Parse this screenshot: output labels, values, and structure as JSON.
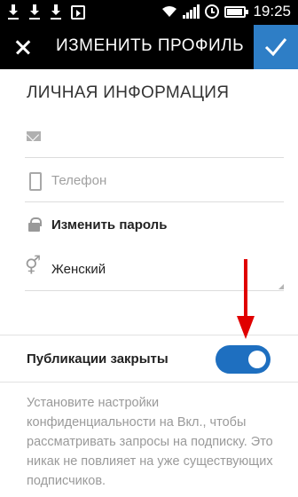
{
  "status_bar": {
    "time": "19:25",
    "icons": [
      "download-icon",
      "download-icon",
      "download-icon",
      "shopping-bag-icon",
      "wifi-icon",
      "signal-icon",
      "alarm-icon",
      "battery-icon"
    ]
  },
  "header": {
    "title": "ИЗМЕНИТЬ ПРОФИЛЬ",
    "close_icon": "close-icon",
    "confirm_icon": "checkmark-icon",
    "accent_color": "#2e7ec6"
  },
  "personal_info": {
    "section_title": "ЛИЧНАЯ ИНФОРМАЦИЯ",
    "email": {
      "icon": "mail-icon",
      "value": ""
    },
    "phone": {
      "icon": "phone-icon",
      "placeholder": "Телефон"
    },
    "password": {
      "icon": "lock-icon",
      "label": "Изменить пароль"
    },
    "gender": {
      "icon": "gender-icon",
      "value": "Женский"
    }
  },
  "privacy": {
    "label": "Публикации закрыты",
    "enabled": true,
    "toggle_color": "#1e6fc0",
    "help_text": "Установите настройки конфиденциальности на Вкл., чтобы рассматривать запросы на подписку. Это никак не повлияет на уже существующих подписчиков."
  },
  "annotation": {
    "arrow_color": "#e00000"
  }
}
